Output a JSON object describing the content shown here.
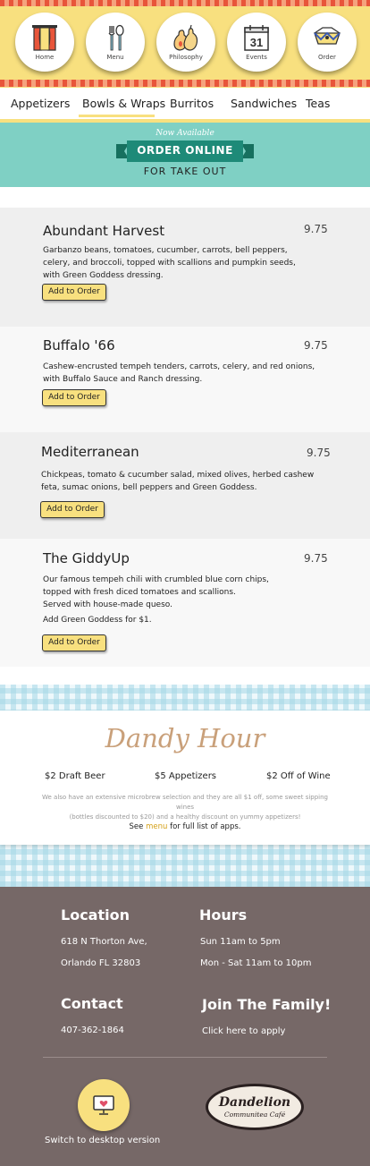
{
  "nav": {
    "items": [
      {
        "label": "Home",
        "icon": "curtains-icon"
      },
      {
        "label": "Menu",
        "icon": "fork-spoon-icon"
      },
      {
        "label": "Philosophy",
        "icon": "pear-icon"
      },
      {
        "label": "Events",
        "icon": "calendar-icon"
      },
      {
        "label": "Order",
        "icon": "takeout-box-icon"
      }
    ],
    "calendar_day": "31"
  },
  "tabs": [
    {
      "label": "Appetizers",
      "active": false
    },
    {
      "label": "Bowls & Wraps",
      "active": true
    },
    {
      "label": "Burritos",
      "active": false
    },
    {
      "label": "Sandwiches",
      "active": false
    },
    {
      "label": "Teas",
      "active": false
    }
  ],
  "banner": {
    "tagline": "Now Available",
    "title": "ORDER ONLINE",
    "subtitle": "FOR TAKE OUT"
  },
  "menu_items": [
    {
      "name": "Abundant Harvest",
      "price": "9.75",
      "description": [
        "Garbanzo beans, tomatoes, cucumber, carrots, bell peppers,",
        "celery, and broccoli, topped with scallions and pumpkin seeds,",
        "with Green Goddess dressing."
      ],
      "button": "Add to Order"
    },
    {
      "name": "Buffalo '66",
      "price": "9.75",
      "description": [
        "Cashew-encrusted tempeh tenders, carrots, celery, and red onions,",
        "with Buffalo Sauce and Ranch dressing."
      ],
      "button": "Add to Order"
    },
    {
      "name": "Mediterranean",
      "price": "9.75",
      "description": [
        "Chickpeas, tomato & cucumber salad, mixed olives, herbed cashew",
        "feta, sumac onions, bell peppers and Green Goddess."
      ],
      "button": "Add to Order"
    },
    {
      "name": "The GiddyUp",
      "price": "9.75",
      "description": [
        "Our famous tempeh chili with crumbled blue corn chips,",
        "topped with fresh diced tomatoes and scallions.",
        "Served with house-made queso."
      ],
      "extra": "Add Green Goddess for $1.",
      "button": "Add to Order"
    }
  ],
  "dandy": {
    "title": "Dandy Hour",
    "deals": [
      "$2 Draft Beer",
      "$5 Appetizers",
      "$2 Off of Wine"
    ],
    "note_line1": "We also have an extensive microbrew selection and they are all $1 off, some sweet sipping wines",
    "note_line2": "(bottles discounted to $20) and a healthy discount on yummy appetizers!",
    "see_prefix": "See ",
    "see_link": "menu",
    "see_suffix": " for full list of apps."
  },
  "footer": {
    "location_heading": "Location",
    "address1": "618 N Thorton Ave,",
    "address2": "Orlando FL 32803",
    "hours_heading": "Hours",
    "hours1": "Sun 11am to 5pm",
    "hours2": "Mon - Sat 11am to 10pm",
    "contact_heading": "Contact",
    "phone": "407-362-1864",
    "join_heading": "Join The Family!",
    "join_link": "Click here to apply",
    "switch_label": "Switch to desktop version",
    "logo_name": "Dandelion",
    "logo_sub": "Communitea Café"
  },
  "colors": {
    "nav_yellow": "#f8e07f",
    "banner_teal": "#7fd0c4",
    "ribbon_green": "#1e8a78",
    "footer_brown": "#766867",
    "dandy_tan": "#c9a07a",
    "link_gold": "#d4a017"
  }
}
